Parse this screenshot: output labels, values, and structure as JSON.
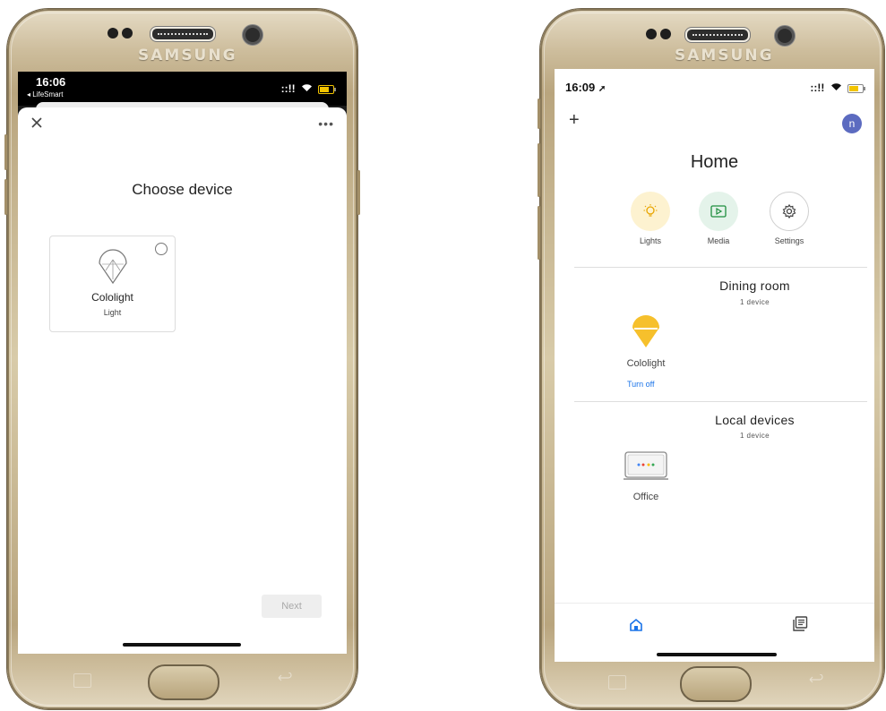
{
  "left_phone": {
    "brand": "SAMSUNG",
    "status": {
      "time": "16:06",
      "back_app": "◂ LifeSmart",
      "signal": "::!!",
      "wifi": "ᯤ"
    },
    "header": {
      "close_icon": "close-icon",
      "more_icon": "more-horizontal-icon"
    },
    "title": "Choose device",
    "device_card": {
      "name": "Cololight",
      "type": "Light",
      "icon": "bulb-outline-icon"
    },
    "next_label": "Next"
  },
  "right_phone": {
    "brand": "SAMSUNG",
    "status": {
      "time": "16:09",
      "signal": "::!!"
    },
    "header": {
      "add_icon": "+",
      "avatar_letter": "n"
    },
    "title": "Home",
    "shortcuts": [
      {
        "label": "Lights",
        "icon": "lightbulb-icon",
        "color": "#fdf2d0"
      },
      {
        "label": "Media",
        "icon": "play-icon",
        "color": "#e4f3ea"
      },
      {
        "label": "Settings",
        "icon": "gear-icon",
        "color": "#ffffff"
      }
    ],
    "rooms": [
      {
        "name": "Dining room",
        "count": "1 device",
        "devices": [
          {
            "name": "Cololight",
            "action": "Turn off",
            "icon": "bulb-filled-icon"
          }
        ]
      },
      {
        "name": "Local devices",
        "count": "1 device",
        "devices": [
          {
            "name": "Office",
            "icon": "google-nest-hub-icon"
          }
        ]
      }
    ],
    "nav": [
      {
        "icon": "home-icon"
      },
      {
        "icon": "feed-icon"
      }
    ]
  },
  "colors": {
    "accent_blue": "#1a73e8",
    "bulb_yellow": "#f6c02c",
    "avatar": "#5c6bc0"
  }
}
